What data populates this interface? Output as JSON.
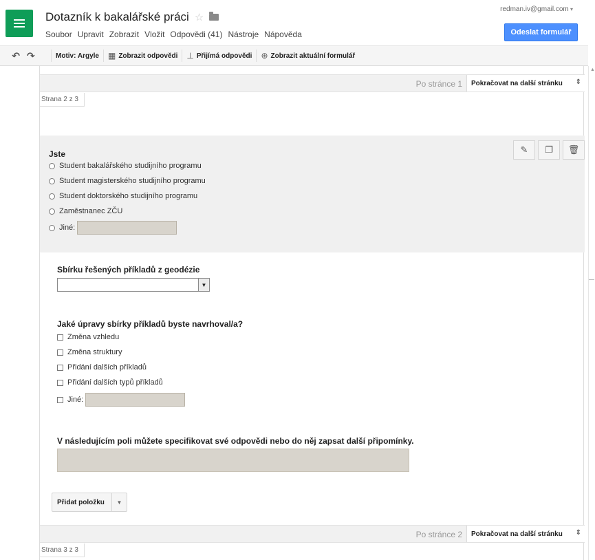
{
  "header": {
    "title": "Dotazník k bakalářské práci",
    "account": "redman.iv@gmail.com",
    "send_button": "Odeslat formulář",
    "menu": [
      "Soubor",
      "Upravit",
      "Zobrazit",
      "Vložit",
      "Odpovědi (41)",
      "Nástroje",
      "Nápověda"
    ]
  },
  "toolbar": {
    "theme": "Motiv: Argyle",
    "view_responses": "Zobrazit odpovědi",
    "accepting": "Přijímá odpovědi",
    "view_live": "Zobrazit aktuální formulář"
  },
  "page_break_1": {
    "after_text": "Po stránce 1",
    "select": "Pokračovat na další stránku",
    "page_tab": "Strana 2 z 3"
  },
  "page_break_2": {
    "after_text": "Po stránce 2",
    "select": "Pokračovat na další stránku",
    "page_tab": "Strana 3 z 3"
  },
  "q1": {
    "title": "Jste",
    "options": [
      "Student bakalářského studijního programu",
      "Student magisterského studijního programu",
      "Student doktorského studijního programu",
      "Zaměstnanec ZČU",
      "Jiné:"
    ]
  },
  "q2": {
    "title": "Sbírku řešených příkladů z geodézie"
  },
  "q3": {
    "title": "Jaké úpravy sbírky příkladů byste navrhoval/a?",
    "options": [
      "Změna vzhledu",
      "Změna struktury",
      "Přidání dalších příkladů",
      "Přidání dalších typů příkladů",
      "Jiné:"
    ]
  },
  "q4": {
    "title": "V následujícím poli můžete specifikovat své odpovědi nebo do něj zapsat další připomínky."
  },
  "add_item": {
    "label": "Přidat položku"
  },
  "icons": {
    "undo": "undo-icon",
    "redo": "redo-icon",
    "pencil": "pencil-icon",
    "duplicate": "duplicate-icon",
    "trash": "trash-icon",
    "star": "star-icon",
    "folder": "folder-icon"
  },
  "colors": {
    "brand_green": "#0f9d58",
    "send_blue": "#4d90fe",
    "active_question_bg": "#f0f0f0"
  }
}
